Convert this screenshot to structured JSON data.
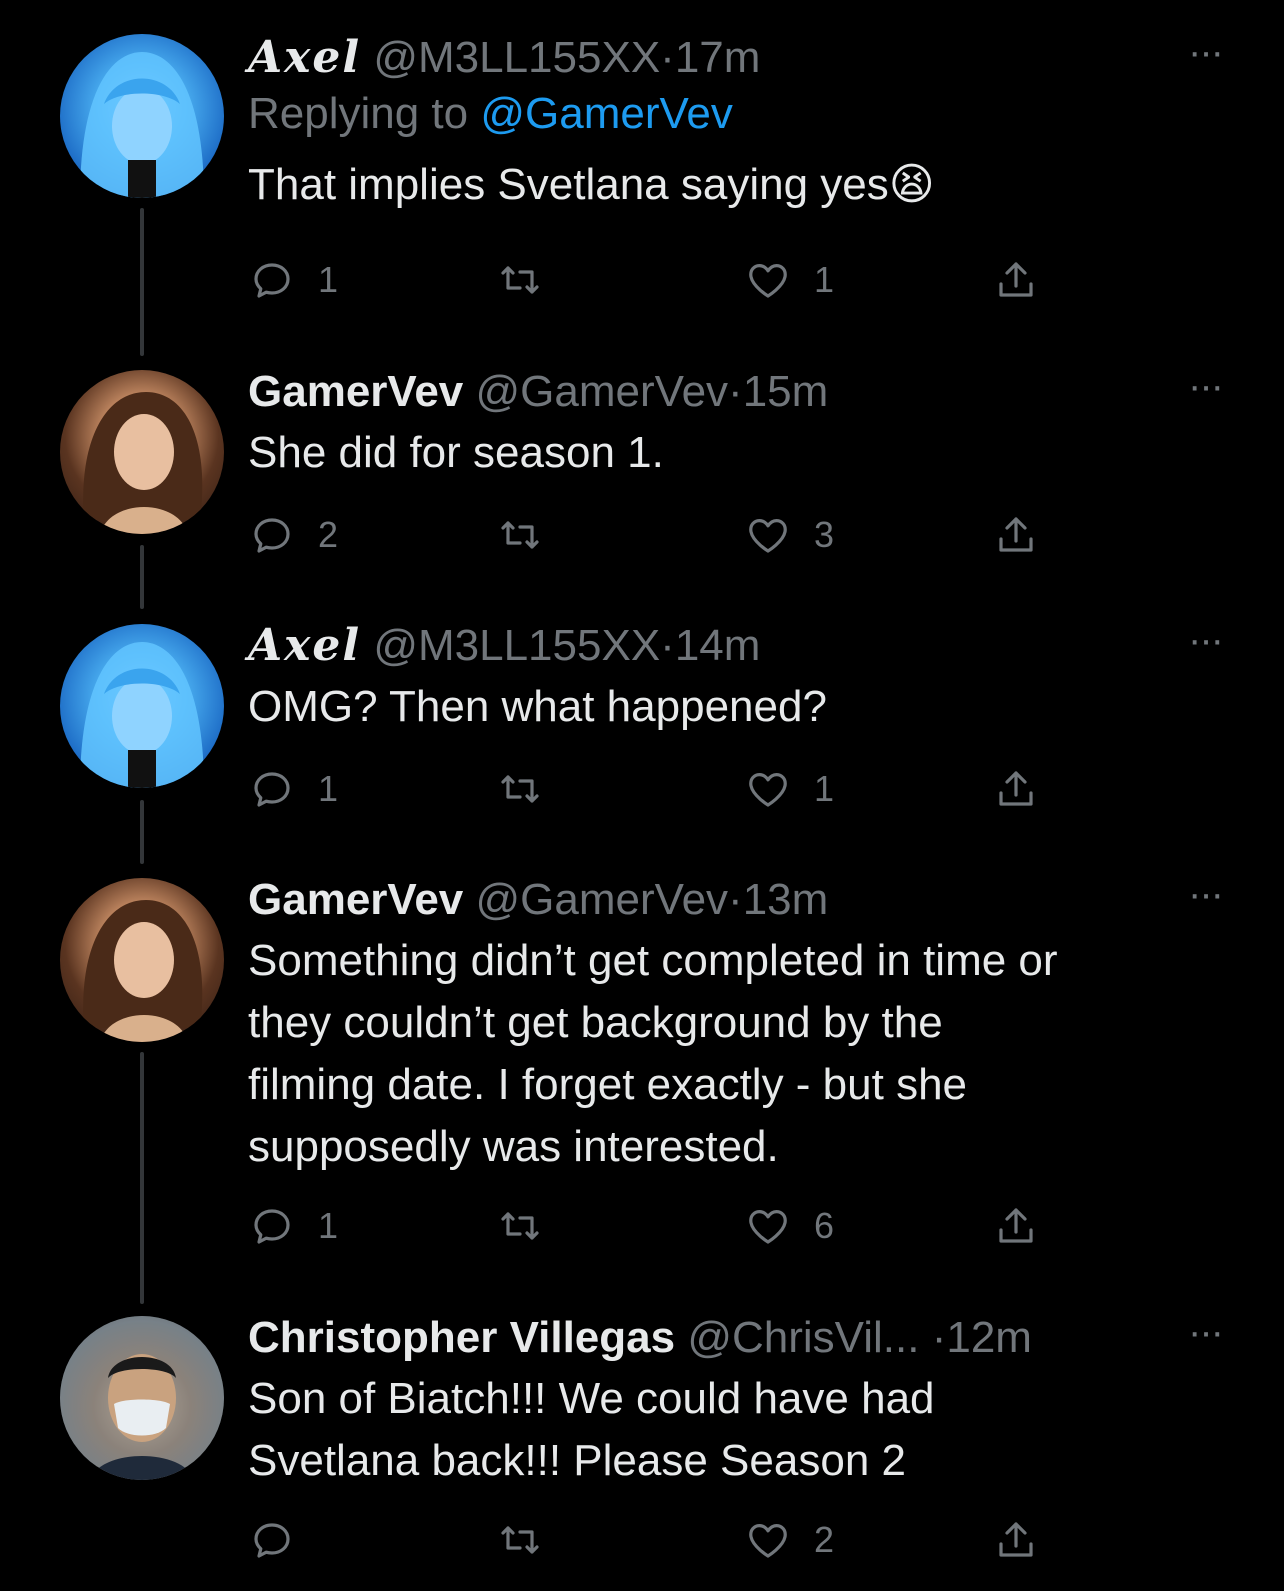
{
  "tweets": [
    {
      "name": "Axel",
      "handle": "@M3LL155XX",
      "dot": "·",
      "time": "17m",
      "replying_prefix": "Replying to ",
      "replying_handle": "@GamerVev",
      "text": "That implies Svetlana saying yes😫",
      "replies": "1",
      "retweets": "",
      "likes": "1",
      "more": "···",
      "avatar": "blue-hair-avatar"
    },
    {
      "name": "GamerVev",
      "handle": "@GamerVev",
      "dot": "·",
      "time": "15m",
      "text": "She did for season 1.",
      "replies": "2",
      "retweets": "",
      "likes": "3",
      "more": "···",
      "avatar": "brunette-avatar"
    },
    {
      "name": "Axel",
      "handle": "@M3LL155XX",
      "dot": "·",
      "time": "14m",
      "text": "OMG? Then what happened?",
      "replies": "1",
      "retweets": "",
      "likes": "1",
      "more": "···",
      "avatar": "blue-hair-avatar"
    },
    {
      "name": "GamerVev",
      "handle": "@GamerVev",
      "dot": "·",
      "time": "13m",
      "text_lines": [
        "Something didn’t get completed in time or",
        "they couldn’t get background by the",
        "filming date. I forget exactly - but she",
        "supposedly was interested."
      ],
      "replies": "1",
      "retweets": "",
      "likes": "6",
      "more": "···",
      "avatar": "brunette-avatar"
    },
    {
      "name": "Christopher Villegas",
      "handle": "@ChrisVil...",
      "dot": "·",
      "time": "12m",
      "text_lines": [
        "Son of Biatch!!! We could have had",
        "Svetlana back!!! Please Season 2"
      ],
      "replies": "",
      "retweets": "",
      "likes": "2",
      "more": "···",
      "avatar": "masked-man-avatar"
    }
  ],
  "icons": {
    "reply": "reply-icon",
    "retweet": "retweet-icon",
    "like": "heart-icon",
    "share": "share-icon"
  },
  "colors": {
    "background": "#000000",
    "text": "#e7e9ea",
    "secondary": "#71767b",
    "link": "#1d9bf0",
    "thread_line": "#333639"
  }
}
